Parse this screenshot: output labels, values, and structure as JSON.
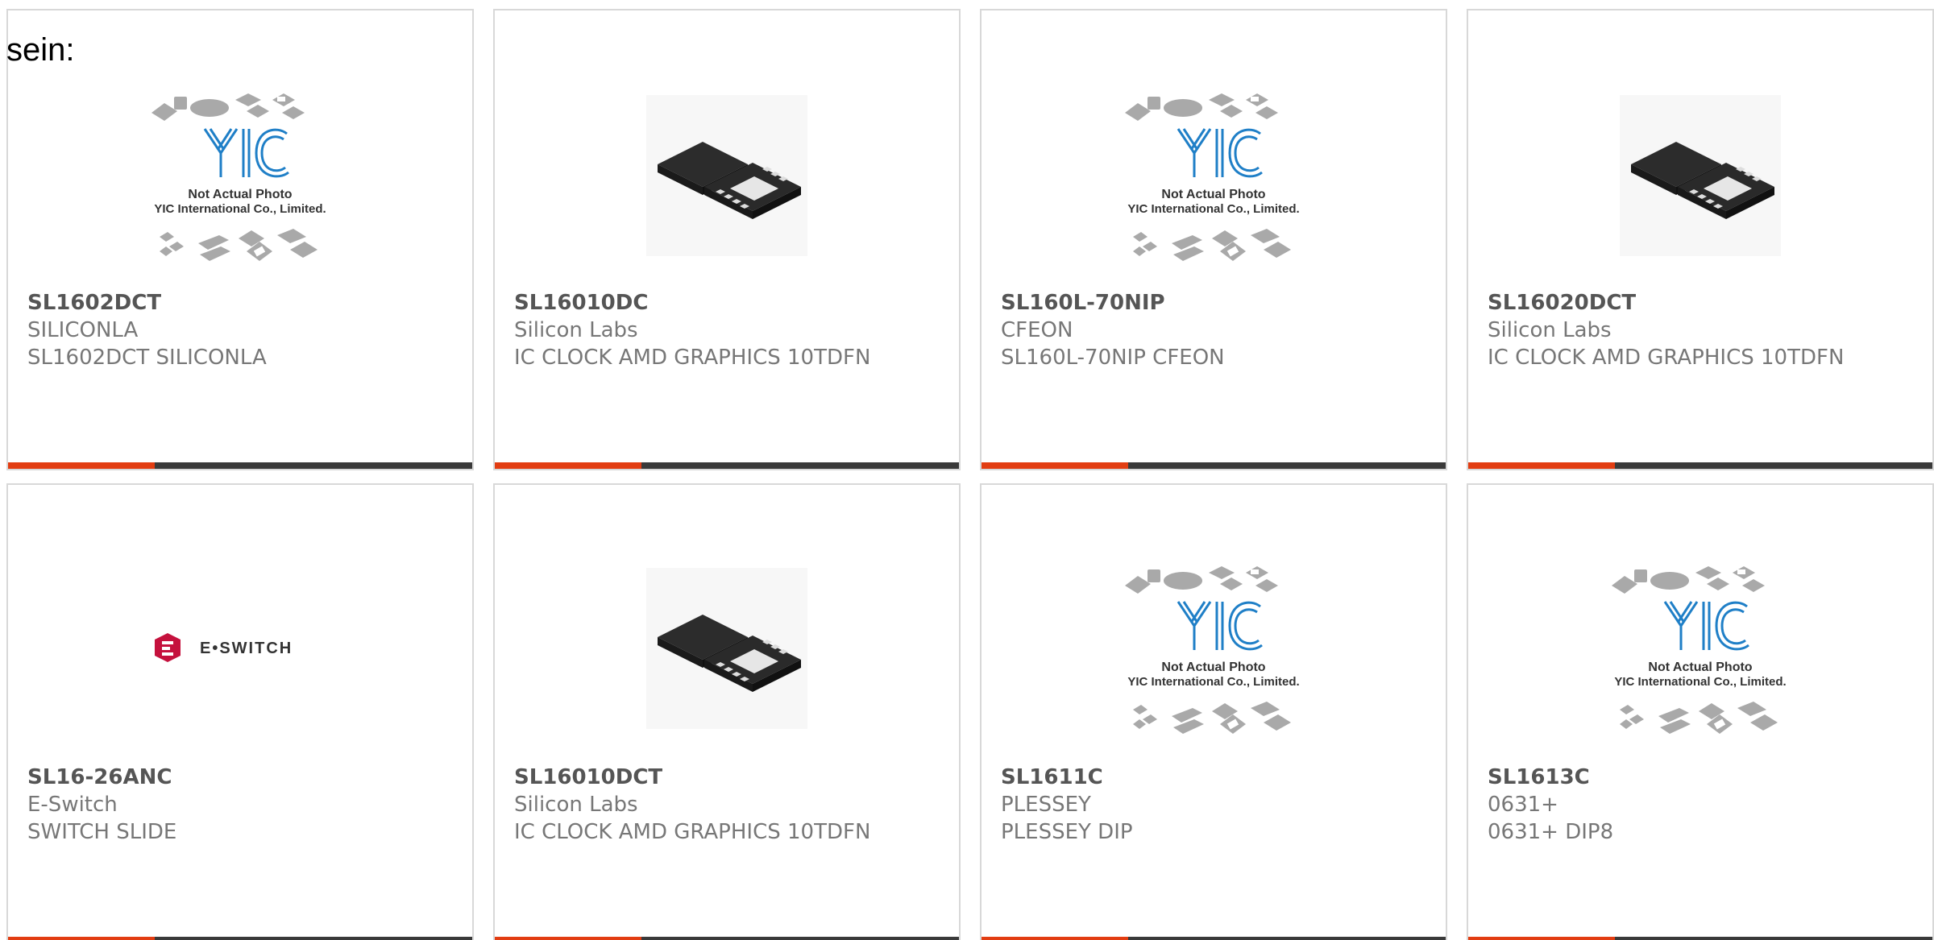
{
  "intro_text": "sein:",
  "colors": {
    "accent": "#e23d12",
    "bar": "#3a3a3a",
    "border": "#d8d8d8",
    "yic_blue": "#1f7fc7",
    "eswitch_red": "#c5113d"
  },
  "products": [
    {
      "part": "SL1602DCT",
      "manufacturer": "SILICONLA",
      "description": "SL1602DCT SILICONLA",
      "image": "yic-placeholder-icon"
    },
    {
      "part": "SL16010DC",
      "manufacturer": "Silicon Labs",
      "description": "IC CLOCK AMD GRAPHICS 10TDFN",
      "image": "tdfn-chip-icon"
    },
    {
      "part": "SL160L-70NIP",
      "manufacturer": "CFEON",
      "description": "SL160L-70NIP CFEON",
      "image": "yic-placeholder-icon"
    },
    {
      "part": "SL16020DCT",
      "manufacturer": "Silicon Labs",
      "description": "IC CLOCK AMD GRAPHICS 10TDFN",
      "image": "tdfn-chip-icon"
    },
    {
      "part": "SL16-26ANC",
      "manufacturer": "E-Switch",
      "description": "SWITCH SLIDE",
      "image": "eswitch-logo"
    },
    {
      "part": "SL16010DCT",
      "manufacturer": "Silicon Labs",
      "description": "IC CLOCK AMD GRAPHICS 10TDFN",
      "image": "tdfn-chip-icon"
    },
    {
      "part": "SL1611C",
      "manufacturer": "PLESSEY",
      "description": "PLESSEY DIP",
      "image": "yic-placeholder-icon"
    },
    {
      "part": "SL1613C",
      "manufacturer": "0631+",
      "description": "0631+ DIP8",
      "image": "yic-placeholder-icon"
    }
  ],
  "placeholder_image": {
    "brand": "YIC",
    "line1": "Not Actual Photo",
    "line2": "YIC International Co., Limited."
  },
  "eswitch_logo": {
    "text": "E•SWITCH"
  }
}
